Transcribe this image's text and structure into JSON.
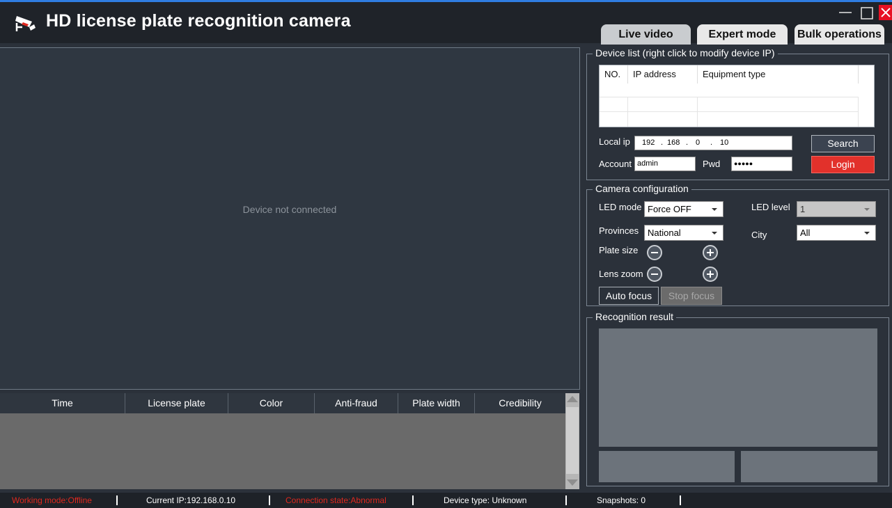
{
  "app": {
    "title": "HD license plate recognition camera",
    "icon": "camera-icon",
    "window_controls": [
      "minimize-icon",
      "maximize-icon",
      "close-icon"
    ]
  },
  "tabs": [
    {
      "label": "Live video",
      "active": true
    },
    {
      "label": "Expert mode",
      "active": false
    },
    {
      "label": "Bulk operations",
      "active": false
    }
  ],
  "video": {
    "status": "Device not connected"
  },
  "results_table": {
    "columns": [
      "Time",
      "License plate",
      "Color",
      "Anti-fraud",
      "Plate width",
      "Credibility"
    ],
    "rows": []
  },
  "device_list": {
    "legend": "Device list (right click to modify device IP)",
    "columns": [
      "NO.",
      "IP address",
      "Equipment type"
    ],
    "rows": [],
    "local_ip_label": "Local ip",
    "local_ip": [
      "192",
      "168",
      "0",
      "10"
    ],
    "account_label": "Account",
    "account": "admin",
    "pwd_label": "Pwd",
    "pwd": "●●●●●",
    "search_label": "Search",
    "login_label": "Login"
  },
  "camera_config": {
    "legend": "Camera configuration",
    "led_mode_label": "LED mode",
    "led_mode": "Force OFF",
    "led_level_label": "LED level",
    "led_level": "1",
    "provinces_label": "Provinces",
    "provinces": "National",
    "city_label": "City",
    "city": "All",
    "plate_size_label": "Plate size",
    "lens_zoom_label": "Lens zoom",
    "auto_focus_label": "Auto focus",
    "stop_focus_label": "Stop focus"
  },
  "recognition": {
    "legend": "Recognition result"
  },
  "status": {
    "working_mode": "Working mode:Offline",
    "current_ip": "Current IP:192.168.0.10",
    "connection_state": "Connection state:Abnormal",
    "device_type": "Device type: Unknown",
    "snapshots": "Snapshots: 0",
    "colors": {
      "alert": "#e0281e",
      "normal": "#ffffff"
    }
  }
}
